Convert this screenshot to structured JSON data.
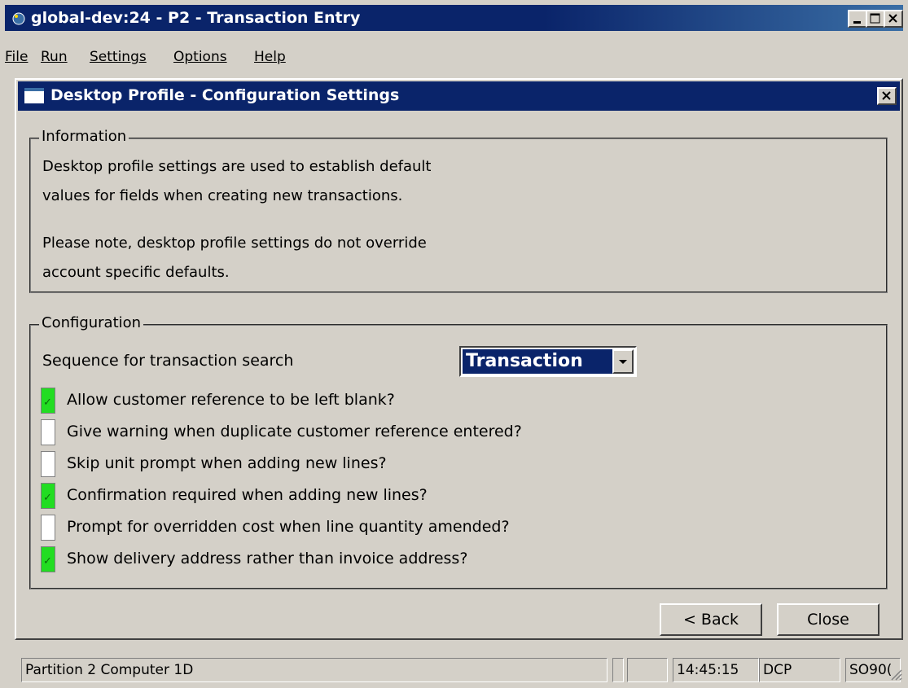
{
  "window": {
    "title": "global-dev:24 - P2 - Transaction Entry"
  },
  "menu": [
    "File",
    "Run",
    "Settings",
    "Options",
    "Help"
  ],
  "dialog": {
    "title": "Desktop Profile - Configuration Settings"
  },
  "information": {
    "title": "Information",
    "lines": [
      "Desktop profile settings are used to establish default",
      "values for fields when creating new transactions.",
      "Please note, desktop profile settings do not override",
      "account specific defaults."
    ]
  },
  "configuration": {
    "title": "Configuration",
    "sequence_label": "Sequence for transaction search",
    "sequence_value": "Transaction",
    "options": [
      {
        "label": "Allow customer reference to be left blank?",
        "checked": true
      },
      {
        "label": "Give warning when duplicate customer reference entered?",
        "checked": false
      },
      {
        "label": "Skip unit prompt when adding new lines?",
        "checked": false
      },
      {
        "label": "Confirmation required when adding new lines?",
        "checked": true
      },
      {
        "label": "Prompt for overridden cost when line quantity amended?",
        "checked": false
      },
      {
        "label": "Show delivery address rather than invoice address?",
        "checked": true
      }
    ]
  },
  "buttons": {
    "back": "< Back",
    "close": "Close"
  },
  "status": {
    "partition": "Partition 2 Computer 1D",
    "time": "14:45:15",
    "mode": "DCP",
    "program": "SO90("
  },
  "colors": {
    "titlebar": "#0a246a",
    "checked": "#22dd22",
    "face": "#d4d0c8"
  }
}
